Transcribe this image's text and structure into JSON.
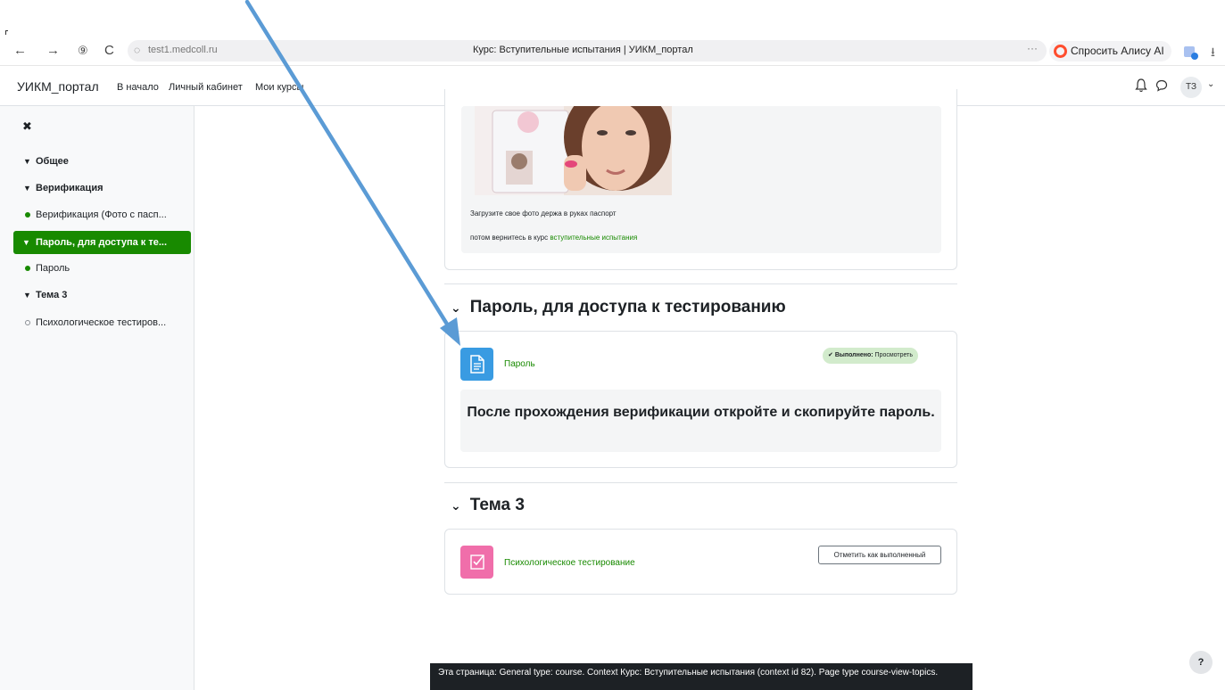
{
  "browser": {
    "back_icon": "←",
    "forward_icon": "→",
    "yandex_icon": "⑨",
    "reload_icon": "C",
    "lock_icon": "◌",
    "url": "test1.medcoll.ru",
    "tab_title": "Курс: Вступительные испытания | УИКМ_портал",
    "menu_dots": "···",
    "alice_label": "Спросить Алису AI",
    "download_icon": "⭳"
  },
  "navbar": {
    "brand": "УИКМ_портал",
    "links": [
      "В начало",
      "Личный кабинет",
      "Мои курсы"
    ],
    "avatar_initials": "ТЗ",
    "caret": "⌄"
  },
  "drawer": {
    "close_icon": "✖",
    "items": [
      {
        "label": "Общее",
        "kind": "section"
      },
      {
        "label": "Верификация",
        "kind": "section"
      },
      {
        "label": "Верификация (Фото с пасп...",
        "kind": "activity-complete"
      },
      {
        "label": "Пароль, для доступа к те...",
        "kind": "section-active"
      },
      {
        "label": "Пароль",
        "kind": "activity-complete"
      },
      {
        "label": "Тема 3",
        "kind": "section"
      },
      {
        "label": "Психологическое тестиров...",
        "kind": "activity-incomplete"
      }
    ]
  },
  "verification_block": {
    "line1": "Загрузите свое фото держа в руках паспорт",
    "line2_prefix": "потом вернитесь в курс ",
    "line2_link": "вступительные испытания"
  },
  "section_password": {
    "title": "Пароль, для доступа к тестированию",
    "activity_name": "Пароль",
    "completion_label": "Выполнено:",
    "completion_value": "Просмотреть",
    "notice": "После прохождения верификации откройте и скопируйте пароль."
  },
  "section_theme3": {
    "title": "Тема 3",
    "activity_name": "Психологическое тестирование",
    "mark_button": "Отметить как выполненный"
  },
  "footer": {
    "text": "Эта страница: General type: course. Context Курс: Вступительные испытания (context id 82). Page type course-view-topics."
  },
  "help_label": "?",
  "colors": {
    "accent_green": "#188a00",
    "page_icon_blue": "#399be2",
    "quiz_icon_pink": "#f06eaa",
    "annotation_arrow": "#5b9bd5"
  }
}
